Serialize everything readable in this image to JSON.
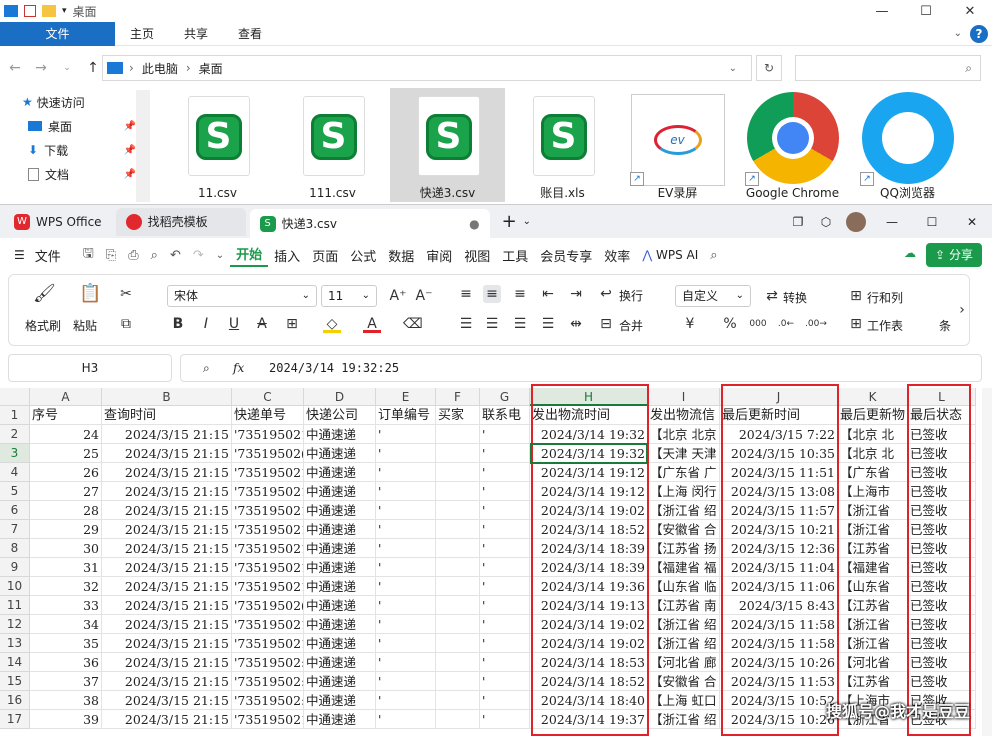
{
  "explorer": {
    "title": "桌面",
    "ribbon_tabs": [
      "文件",
      "主页",
      "共享",
      "查看"
    ],
    "breadcrumb": [
      "此电脑",
      "桌面"
    ],
    "nav": [
      {
        "label": "快速访问",
        "icon": "star-icon",
        "pinned": false
      },
      {
        "label": "桌面",
        "icon": "desktop-icon",
        "pinned": true
      },
      {
        "label": "下载",
        "icon": "download-icon",
        "pinned": true
      },
      {
        "label": "文档",
        "icon": "document-icon",
        "pinned": true
      }
    ],
    "files": [
      {
        "name": "11.csv",
        "type": "csv"
      },
      {
        "name": "111.csv",
        "type": "csv"
      },
      {
        "name": "快递3.csv",
        "type": "csv",
        "selected": true
      },
      {
        "name": "账目.xls",
        "type": "csv"
      },
      {
        "name": "EV录屏",
        "type": "ev"
      },
      {
        "name": "Google Chrome",
        "type": "chrome"
      },
      {
        "name": "QQ浏览器",
        "type": "qq"
      }
    ]
  },
  "wps": {
    "tabs": [
      {
        "label": "WPS Office",
        "color": "#e0282e"
      },
      {
        "label": "找稻壳模板",
        "color": "#e0282e"
      },
      {
        "label": "快递3.csv",
        "color": "#1a9a4a"
      }
    ],
    "menu": [
      "文件",
      "开始",
      "插入",
      "页面",
      "公式",
      "数据",
      "审阅",
      "视图",
      "工具",
      "会员专享",
      "效率",
      "WPS AI"
    ],
    "active_menu": "开始",
    "share": "分享",
    "toolbar": {
      "format_painter": "格式刷",
      "paste": "粘贴",
      "font": "宋体",
      "font_size": "11",
      "wrap": "换行",
      "merge": "合并",
      "number_format": "自定义",
      "convert": "转换",
      "row_col": "行和列",
      "worksheet": "工作表",
      "cond": "条"
    },
    "namebox": "H3",
    "formula": "2024/3/14 19:32:25",
    "fx": "fx"
  },
  "sheet": {
    "columns": [
      "A",
      "B",
      "C",
      "D",
      "E",
      "F",
      "G",
      "H",
      "I",
      "J",
      "K",
      "L"
    ],
    "headers": [
      "序号",
      "查询时间",
      "快递单号",
      "快递公司",
      "订单编号",
      "买家",
      "联系电",
      "发出物流时间",
      "发出物流信",
      "最后更新时间",
      "最后更新物",
      "最后状态"
    ],
    "rows": [
      [
        "24",
        "2024/3/15 21:15",
        "'735195021",
        "中通速递",
        "'",
        "",
        "'",
        "2024/3/14 19:32",
        "【北京 北京",
        "2024/3/15 7:22",
        "【北京 北",
        "已签收"
      ],
      [
        "25",
        "2024/3/15 21:15",
        "'73519502(",
        "中通速递",
        "'",
        "",
        "'",
        "2024/3/14 19:32",
        "【天津 天津",
        "2024/3/15 10:35",
        "【北京 北",
        "已签收"
      ],
      [
        "26",
        "2024/3/15 21:15",
        "'735195021",
        "中通速递",
        "'",
        "",
        "'",
        "2024/3/14 19:12",
        "【广东省 广",
        "2024/3/15 11:51",
        "【广东省",
        "已签收"
      ],
      [
        "27",
        "2024/3/15 21:15",
        "'735195021",
        "中通速递",
        "'",
        "",
        "'",
        "2024/3/14 19:12",
        "【上海 闵行",
        "2024/3/15 13:08",
        "【上海市",
        "已签收"
      ],
      [
        "28",
        "2024/3/15 21:15",
        "'735195021",
        "中通速递",
        "'",
        "",
        "'",
        "2024/3/14 19:02",
        "【浙江省 绍",
        "2024/3/15 11:57",
        "【浙江省",
        "已签收"
      ],
      [
        "29",
        "2024/3/15 21:15",
        "'735195021",
        "中通速递",
        "'",
        "",
        "'",
        "2024/3/14 18:52",
        "【安徽省 合",
        "2024/3/15 10:21",
        "【浙江省",
        "已签收"
      ],
      [
        "30",
        "2024/3/15 21:15",
        "'735195021",
        "中通速递",
        "'",
        "",
        "'",
        "2024/3/14 18:39",
        "【江苏省 扬",
        "2024/3/15 12:36",
        "【江苏省",
        "已签收"
      ],
      [
        "31",
        "2024/3/15 21:15",
        "'735195021",
        "中通速递",
        "'",
        "",
        "'",
        "2024/3/14 18:39",
        "【福建省 福",
        "2024/3/15 11:04",
        "【福建省",
        "已签收"
      ],
      [
        "32",
        "2024/3/15 21:15",
        "'735195021",
        "中通速递",
        "'",
        "",
        "'",
        "2024/3/14 19:36",
        "【山东省 临",
        "2024/3/15 11:06",
        "【山东省",
        "已签收"
      ],
      [
        "33",
        "2024/3/15 21:15",
        "'73519502(",
        "中通速递",
        "'",
        "",
        "'",
        "2024/3/14 19:13",
        "【江苏省 南",
        "2024/3/15 8:43",
        "【江苏省",
        "已签收"
      ],
      [
        "34",
        "2024/3/15 21:15",
        "'735195021",
        "中通速递",
        "'",
        "",
        "'",
        "2024/3/14 19:02",
        "【浙江省 绍",
        "2024/3/15 11:58",
        "【浙江省",
        "已签收"
      ],
      [
        "35",
        "2024/3/15 21:15",
        "'735195021",
        "中通速递",
        "'",
        "",
        "'",
        "2024/3/14 19:02",
        "【浙江省 绍",
        "2024/3/15 11:58",
        "【浙江省",
        "已签收"
      ],
      [
        "36",
        "2024/3/15 21:15",
        "'73519502:",
        "中通速递",
        "'",
        "",
        "'",
        "2024/3/14 18:53",
        "【河北省 廊",
        "2024/3/15 10:26",
        "【河北省",
        "已签收"
      ],
      [
        "37",
        "2024/3/15 21:15",
        "'73519502:",
        "中通速递",
        "'",
        "",
        "'",
        "2024/3/14 18:52",
        "【安徽省 合",
        "2024/3/15 11:53",
        "【江苏省",
        "已签收"
      ],
      [
        "38",
        "2024/3/15 21:15",
        "'73519502:",
        "中通速递",
        "'",
        "",
        "'",
        "2024/3/14 18:40",
        "【上海 虹口",
        "2024/3/15 10:52",
        "【上海市",
        "已签收"
      ],
      [
        "39",
        "2024/3/15 21:15",
        "'735195021",
        "中通速递",
        "'",
        "",
        "'",
        "2024/3/14 19:37",
        "【浙江省 绍",
        "2024/3/15 10:26",
        "【浙江省",
        "已签收"
      ]
    ]
  },
  "watermark": "搜狐号@我才是豆豆"
}
